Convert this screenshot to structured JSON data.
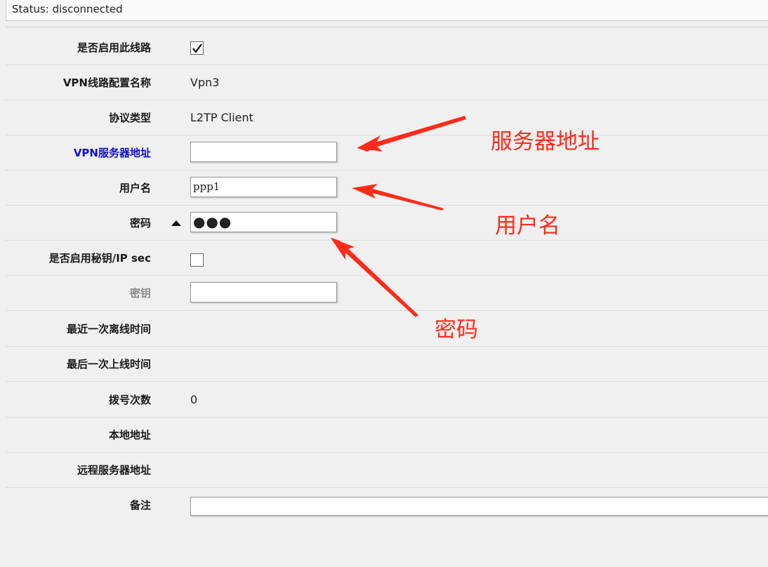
{
  "status": {
    "text": "Status: disconnected"
  },
  "form": {
    "enable": {
      "label": "是否启用此线路",
      "checked": true
    },
    "name": {
      "label": "VPN线路配置名称",
      "value": "Vpn3"
    },
    "protocol": {
      "label": "协议类型",
      "value": "L2TP Client"
    },
    "server": {
      "label": "VPN服务器地址",
      "value": ""
    },
    "username": {
      "label": "用户名",
      "value": "ppp1"
    },
    "password": {
      "label": "密码",
      "masked": "●●●"
    },
    "ipsec_enable": {
      "label": "是否启用秘钥/IP sec",
      "checked": false
    },
    "secret": {
      "label": "密钥",
      "value": ""
    },
    "last_offline": {
      "label": "最近一次离线时间",
      "value": ""
    },
    "last_online": {
      "label": "最后一次上线时间",
      "value": ""
    },
    "dial_count": {
      "label": "拨号次数",
      "value": "0"
    },
    "local_addr": {
      "label": "本地地址",
      "value": ""
    },
    "remote_addr": {
      "label": "远程服务器地址",
      "value": ""
    },
    "remark": {
      "label": "备注",
      "value": ""
    }
  },
  "annotations": {
    "server": "服务器地址",
    "username": "用户名",
    "password": "密码",
    "color": "#ff2a1a"
  },
  "icons": {
    "checkbox_check": "check-icon",
    "password_toggle": "triangle-up-icon"
  }
}
